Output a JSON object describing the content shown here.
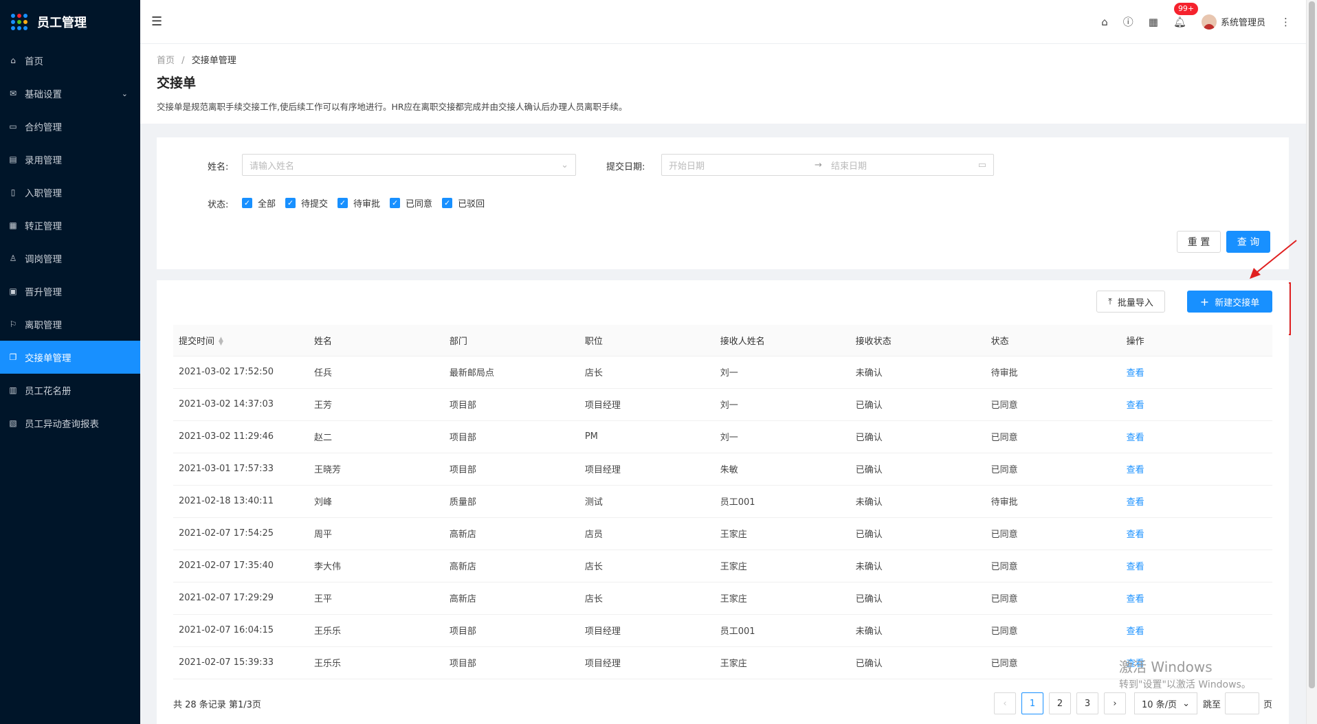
{
  "app": {
    "title": "员工管理"
  },
  "sidebar": {
    "items": [
      {
        "label": "首页",
        "icon": "home-icon",
        "glyph": "⌂"
      },
      {
        "label": "基础设置",
        "icon": "mail-icon",
        "glyph": "✉",
        "arrow": "⌄"
      },
      {
        "label": "合约管理",
        "icon": "calendar-icon",
        "glyph": "▭"
      },
      {
        "label": "录用管理",
        "icon": "form-icon",
        "glyph": "▤"
      },
      {
        "label": "入职管理",
        "icon": "file-icon",
        "glyph": "▯"
      },
      {
        "label": "转正管理",
        "icon": "grid-icon",
        "glyph": "▦"
      },
      {
        "label": "调岗管理",
        "icon": "user-icon",
        "glyph": "♙"
      },
      {
        "label": "晋升管理",
        "icon": "report-icon",
        "glyph": "▣"
      },
      {
        "label": "离职管理",
        "icon": "leave-icon",
        "glyph": "⚐"
      },
      {
        "label": "交接单管理",
        "icon": "copy-icon",
        "glyph": "❐",
        "active": true
      },
      {
        "label": "员工花名册",
        "icon": "book-icon",
        "glyph": "▥"
      },
      {
        "label": "员工异动查询报表",
        "icon": "chart-icon",
        "glyph": "▧"
      }
    ]
  },
  "topbar": {
    "badge": "99+",
    "user_name": "系统管理员"
  },
  "breadcrumb": {
    "home": "首页",
    "sep": "/",
    "current": "交接单管理"
  },
  "page": {
    "title": "交接单",
    "description": "交接单是规范离职手续交接工作,使后续工作可以有序地进行。HR应在离职交接都完成并由交接人确认后办理人员离职手续。"
  },
  "search": {
    "name_label": "姓名:",
    "name_placeholder": "请输入姓名",
    "date_label": "提交日期:",
    "start_placeholder": "开始日期",
    "arrow": "→",
    "end_placeholder": "结束日期",
    "status_label": "状态:",
    "statuses": [
      "全部",
      "待提交",
      "待审批",
      "已同意",
      "已驳回"
    ],
    "reset": "重 置",
    "query": "查 询"
  },
  "toolbar": {
    "import": "批量导入",
    "create": "新建交接单"
  },
  "table": {
    "columns": [
      "提交时间",
      "姓名",
      "部门",
      "职位",
      "接收人姓名",
      "接收状态",
      "状态",
      "操作"
    ],
    "rows": [
      [
        "2021-03-02 17:52:50",
        "任兵",
        "最新邮局点",
        "店长",
        "刘一",
        "未确认",
        "待审批",
        "查看"
      ],
      [
        "2021-03-02 14:37:03",
        "王芳",
        "项目部",
        "项目经理",
        "刘一",
        "已确认",
        "已同意",
        "查看"
      ],
      [
        "2021-03-02 11:29:46",
        "赵二",
        "项目部",
        "PM",
        "刘一",
        "已确认",
        "已同意",
        "查看"
      ],
      [
        "2021-03-01 17:57:33",
        "王晓芳",
        "项目部",
        "项目经理",
        "朱敏",
        "已确认",
        "已同意",
        "查看"
      ],
      [
        "2021-02-18 13:40:11",
        "刘峰",
        "质量部",
        "测试",
        "员工001",
        "未确认",
        "待审批",
        "查看"
      ],
      [
        "2021-02-07 17:54:25",
        "周平",
        "高新店",
        "店员",
        "王家庄",
        "已确认",
        "已同意",
        "查看"
      ],
      [
        "2021-02-07 17:35:40",
        "李大伟",
        "高新店",
        "店长",
        "王家庄",
        "未确认",
        "已同意",
        "查看"
      ],
      [
        "2021-02-07 17:29:29",
        "王平",
        "高新店",
        "店长",
        "王家庄",
        "已确认",
        "已同意",
        "查看"
      ],
      [
        "2021-02-07 16:04:15",
        "王乐乐",
        "项目部",
        "项目经理",
        "员工001",
        "未确认",
        "已同意",
        "查看"
      ],
      [
        "2021-02-07 15:39:33",
        "王乐乐",
        "项目部",
        "项目经理",
        "王家庄",
        "已确认",
        "已同意",
        "查看"
      ]
    ]
  },
  "pagination": {
    "total": "共 28 条记录 第1/3页",
    "pages": [
      "1",
      "2",
      "3"
    ],
    "current": "1",
    "page_size": "10 条/页",
    "jump_label": "跳至",
    "page_unit": "页"
  },
  "watermark": {
    "line1": "激活 Windows",
    "line2": "转到\"设置\"以激活 Windows。"
  }
}
